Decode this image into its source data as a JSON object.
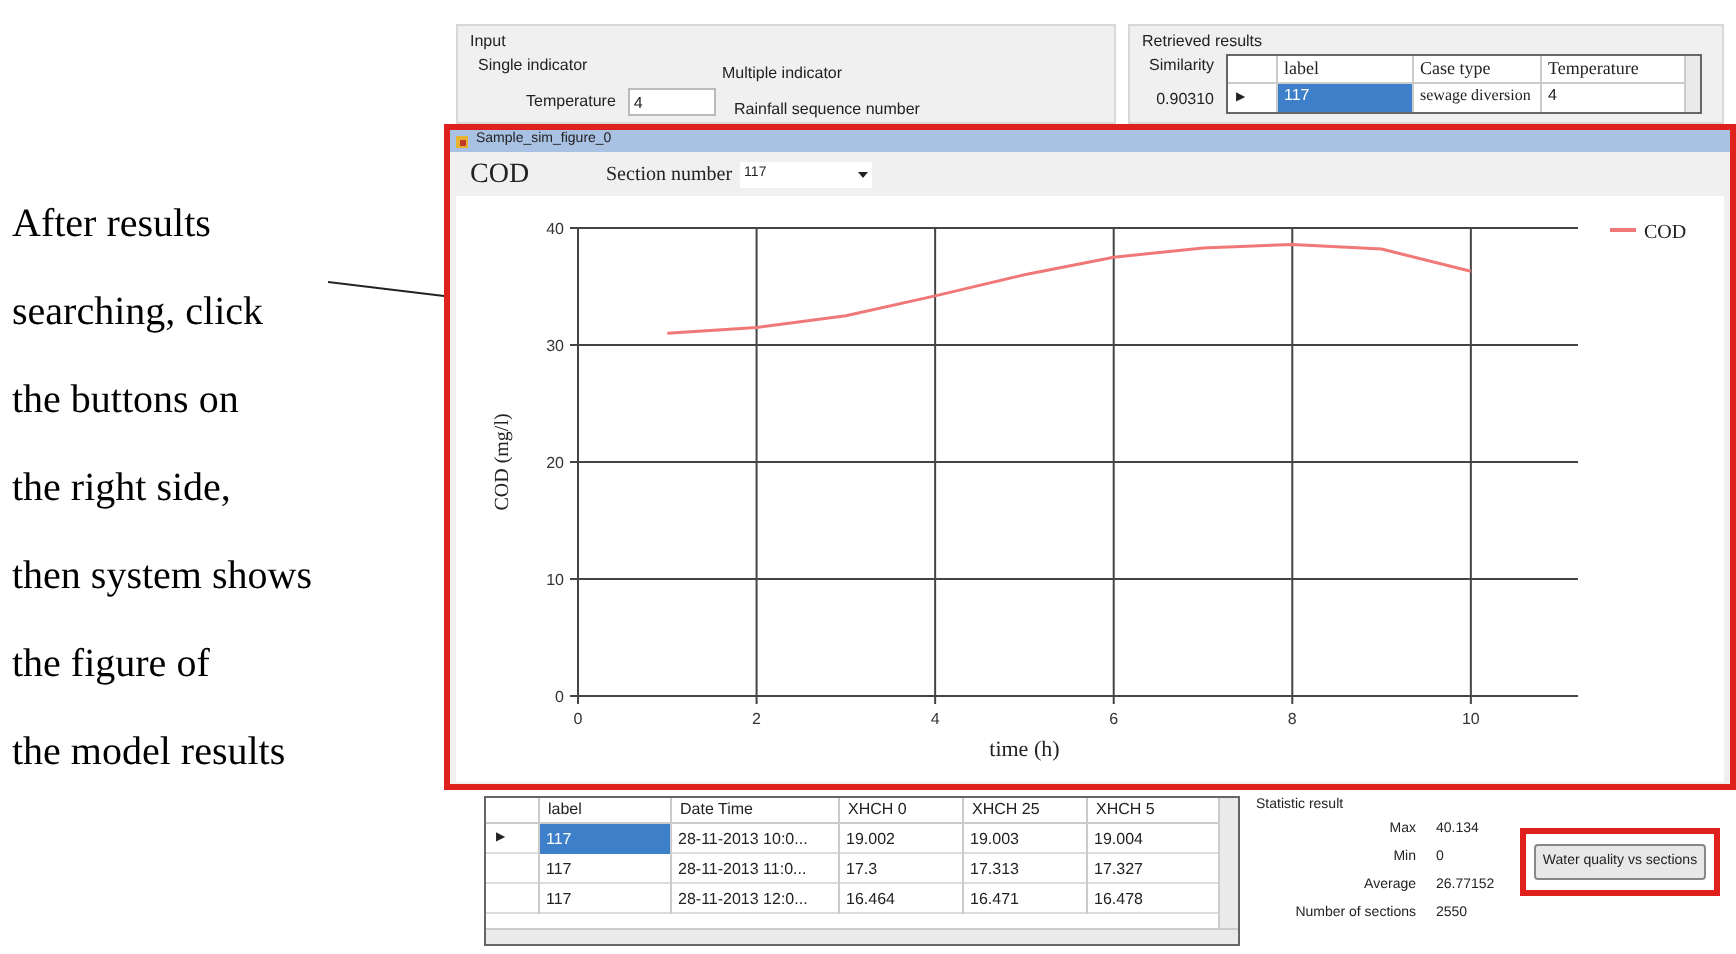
{
  "annotation": {
    "lines": [
      "After results",
      "searching, click",
      "the buttons on",
      "the right side,",
      "then system shows",
      "the figure of",
      "the model results"
    ]
  },
  "input": {
    "title": "Input",
    "single_indicator": {
      "title": "Single indicator",
      "label": "Temperature",
      "value": "4"
    },
    "multiple_indicator": {
      "title": "Multiple indicator",
      "label": "Rainfall sequence number"
    }
  },
  "retrieved": {
    "title": "Retrieved results",
    "similarity_label": "Similarity",
    "similarity": "0.90310",
    "columns": [
      "label",
      "Case type",
      "Temperature"
    ],
    "rows": [
      {
        "selected": true,
        "marker": "▶",
        "cells": [
          "117",
          "sewage diversion",
          "4"
        ]
      }
    ]
  },
  "figure_window": {
    "title": "Sample_sim_figure_0",
    "highlighted": true,
    "heading": "COD",
    "section_label": "Section number",
    "section_value": "117",
    "chart_data": {
      "type": "line",
      "xlabel": "time (h)",
      "ylabel": "COD (mg/l)",
      "x": [
        1,
        2,
        3,
        4,
        5,
        6,
        7,
        8,
        9,
        10
      ],
      "series": [
        {
          "name": "COD",
          "color": "#f07878",
          "values": [
            31,
            31.5,
            32.5,
            34.2,
            36,
            37.5,
            38.3,
            38.6,
            38.2,
            36.3
          ]
        }
      ],
      "grid": true,
      "xlim": [
        0,
        11.2
      ],
      "ylim": [
        0,
        40
      ],
      "xticks": [
        0,
        2,
        4,
        6,
        8,
        10
      ],
      "yticks": [
        0,
        10,
        20,
        30,
        40
      ]
    }
  },
  "results_table": {
    "columns": [
      "label",
      "Date Time",
      "XHCH 0",
      "XHCH 25",
      "XHCH 5"
    ],
    "rows": [
      {
        "selected": true,
        "marker": "▶",
        "cells": [
          "117",
          "28-11-2013 10:0...",
          "19.002",
          "19.003",
          "19.004"
        ]
      },
      {
        "selected": false,
        "cells": [
          "117",
          "28-11-2013 11:0...",
          "17.3",
          "17.313",
          "17.327"
        ]
      },
      {
        "selected": false,
        "cells": [
          "117",
          "28-11-2013 12:0...",
          "16.464",
          "16.471",
          "16.478"
        ]
      }
    ]
  },
  "statistics": {
    "title": "Statistic result",
    "items": [
      {
        "label": "Max",
        "value": "40.134"
      },
      {
        "label": "Min",
        "value": "0"
      },
      {
        "label": "Average",
        "value": "26.77152"
      },
      {
        "label": "Number of sections",
        "value": "2550"
      }
    ]
  },
  "action_button": {
    "label": "Water quality vs sections",
    "highlighted": true
  }
}
